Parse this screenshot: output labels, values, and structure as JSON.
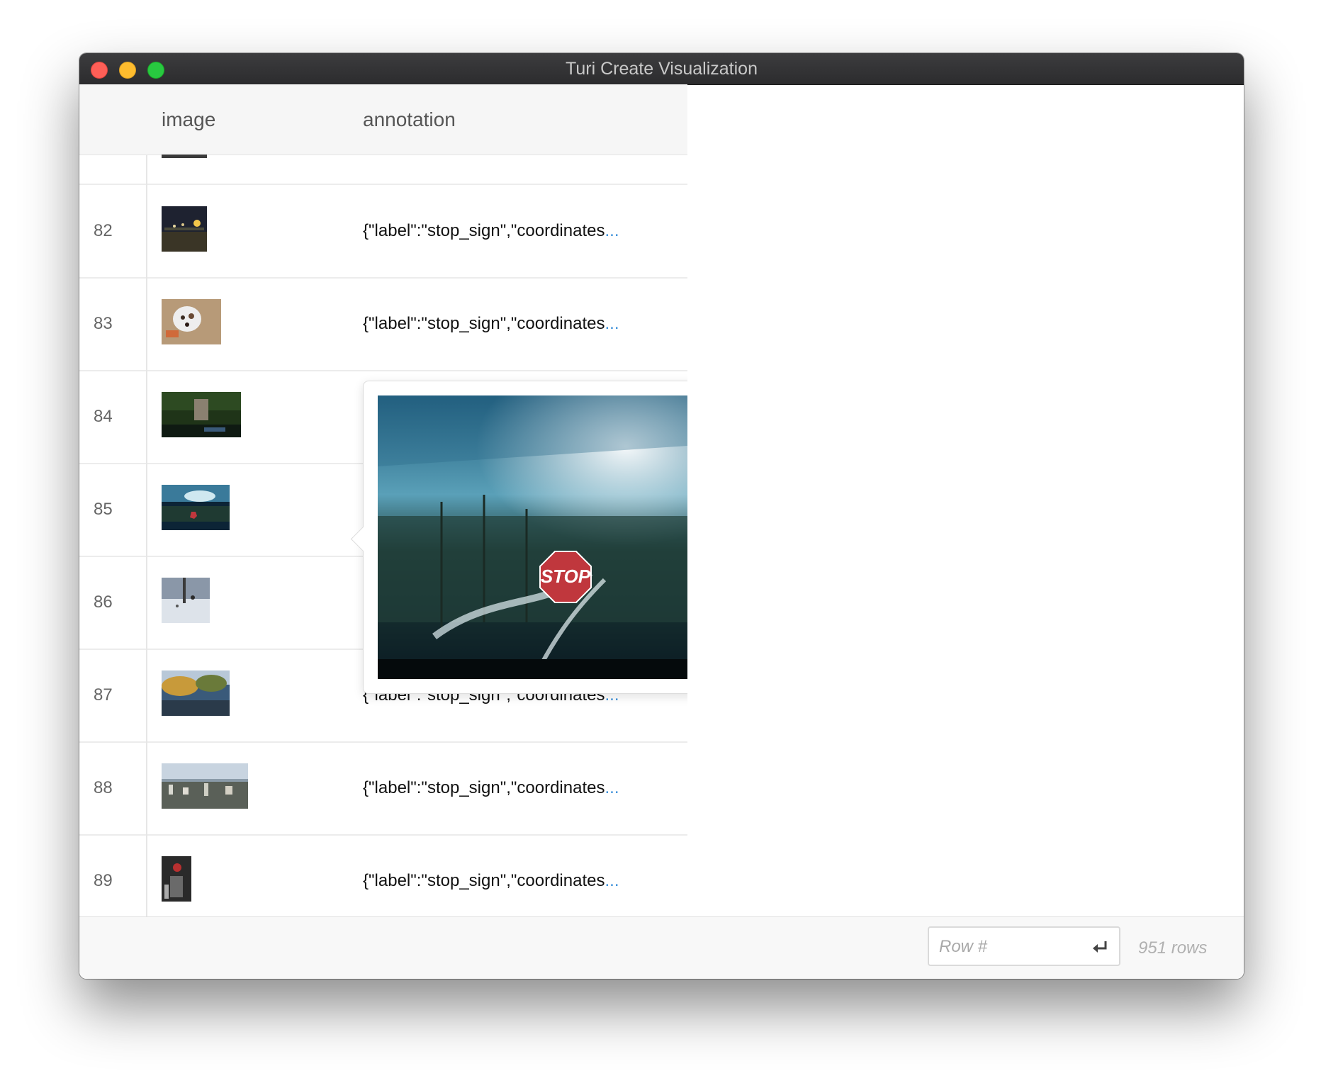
{
  "window": {
    "title": "Turi Create Visualization"
  },
  "table": {
    "columns": [
      "image",
      "annotation"
    ],
    "rows": [
      {
        "index": "82",
        "annotation": "{\"label\":\"stop_sign\",\"coordinates",
        "more": "..."
      },
      {
        "index": "83",
        "annotation": "{\"label\":\"stop_sign\",\"coordinates",
        "more": "..."
      },
      {
        "index": "84",
        "annotation": "",
        "more": ""
      },
      {
        "index": "85",
        "annotation": "",
        "more": ""
      },
      {
        "index": "86",
        "annotation": "",
        "more": ""
      },
      {
        "index": "87",
        "annotation": "{\"label\":\"stop_sign\",\"coordinates",
        "more": "..."
      },
      {
        "index": "88",
        "annotation": "{\"label\":\"stop_sign\",\"coordinates",
        "more": "..."
      },
      {
        "index": "89",
        "annotation": "{\"label\":\"stop_sign\",\"coordinates",
        "more": "..."
      }
    ]
  },
  "popover": {
    "sign_text": "STOP"
  },
  "footer": {
    "row_input_placeholder": "Row #",
    "row_count": "951 rows"
  },
  "colors": {
    "link": "#3a8fd9",
    "stop_sign": "#c0373d"
  }
}
